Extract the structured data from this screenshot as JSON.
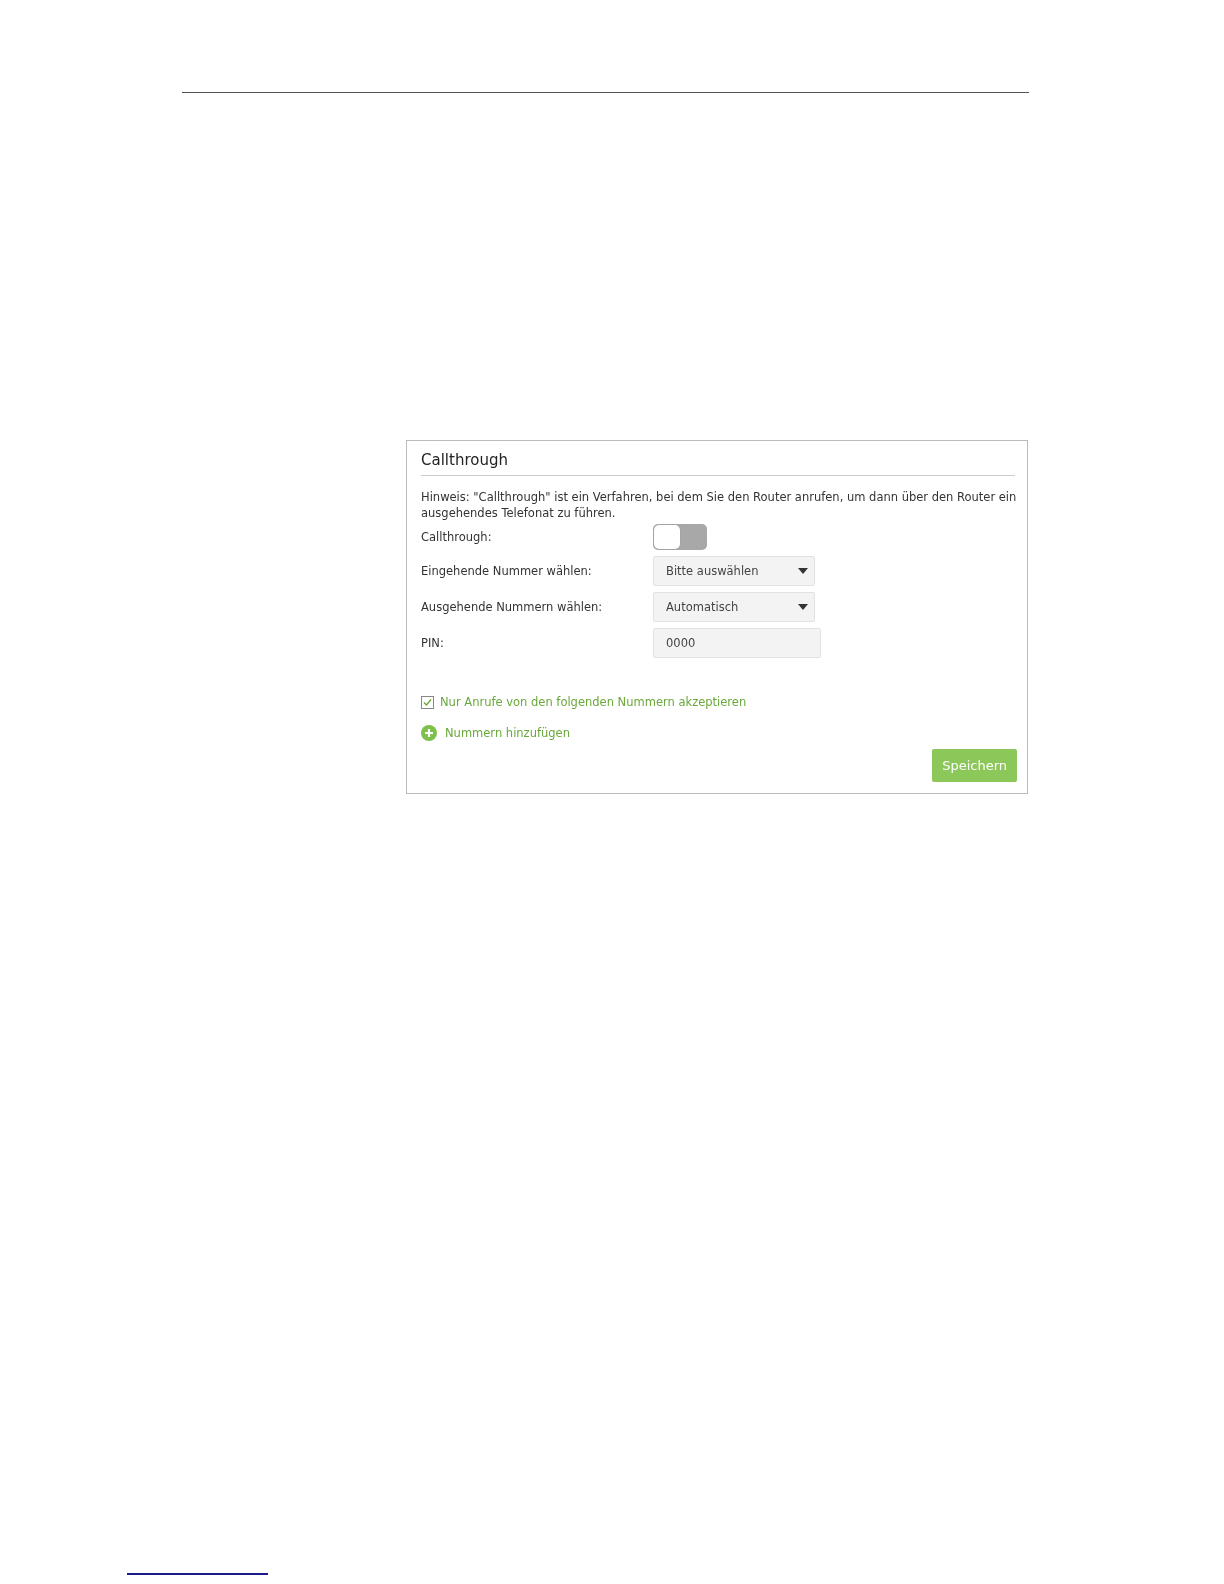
{
  "panel": {
    "title": "Callthrough",
    "note": "Hinweis: \"Callthrough\" ist ein Verfahren, bei dem Sie den Router anrufen, um dann über den Router ein ausgehendes Telefonat zu führen.",
    "fields": [
      {
        "kind": "toggle",
        "label": "Callthrough:",
        "on": false
      },
      {
        "kind": "select",
        "label": "Eingehende Nummer wählen:",
        "value": "Bitte auswählen"
      },
      {
        "kind": "select",
        "label": "Ausgehende Nummern wählen:",
        "value": "Automatisch"
      },
      {
        "kind": "input",
        "label": "PIN:",
        "value": "0000"
      }
    ],
    "accept_only": {
      "label": "Nur Anrufe von den folgenden Nummern akzeptieren",
      "checked": true
    },
    "add_link": "Nummern hinzufügen",
    "save_button": "Speichern"
  }
}
